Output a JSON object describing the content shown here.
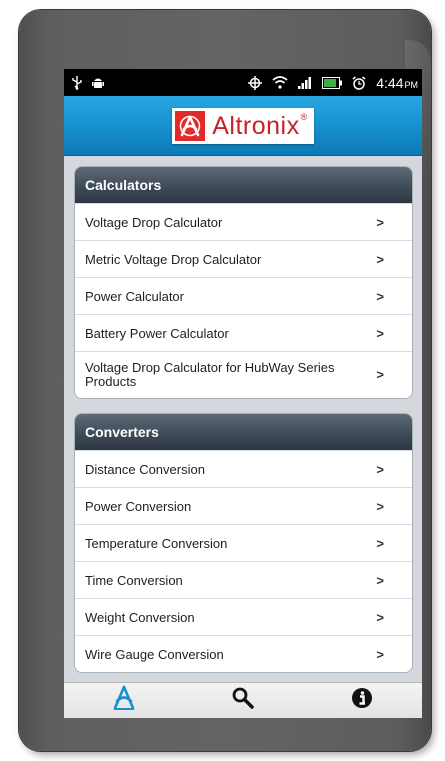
{
  "status_bar": {
    "time": "4:44",
    "ampm": "PM",
    "icons": [
      "usb-icon",
      "android-icon",
      "gps-icon",
      "wifi-icon",
      "signal-icon",
      "battery-icon",
      "alarm-icon"
    ]
  },
  "header": {
    "brand": "Altronix",
    "reg_mark": "®"
  },
  "calculators": {
    "title": "Calculators",
    "items": [
      {
        "label": "Voltage Drop Calculator"
      },
      {
        "label": "Metric Voltage Drop Calculator"
      },
      {
        "label": "Power Calculator"
      },
      {
        "label": "Battery Power Calculator"
      },
      {
        "label": "Voltage Drop Calculator for HubWay Series Products"
      }
    ]
  },
  "converters": {
    "title": "Converters",
    "items": [
      {
        "label": "Distance Conversion"
      },
      {
        "label": "Power Conversion"
      },
      {
        "label": "Temperature Conversion"
      },
      {
        "label": "Time Conversion"
      },
      {
        "label": "Weight Conversion"
      },
      {
        "label": "Wire Gauge Conversion"
      }
    ]
  },
  "chevron": ">",
  "tabbar": {
    "tabs": [
      "altronix-home-icon",
      "search-icon",
      "info-icon"
    ]
  },
  "colors": {
    "header_blue": "#1690cd",
    "brand_red": "#c92127",
    "section_header": "#3d4856",
    "tab_active": "#1a8fd0"
  }
}
